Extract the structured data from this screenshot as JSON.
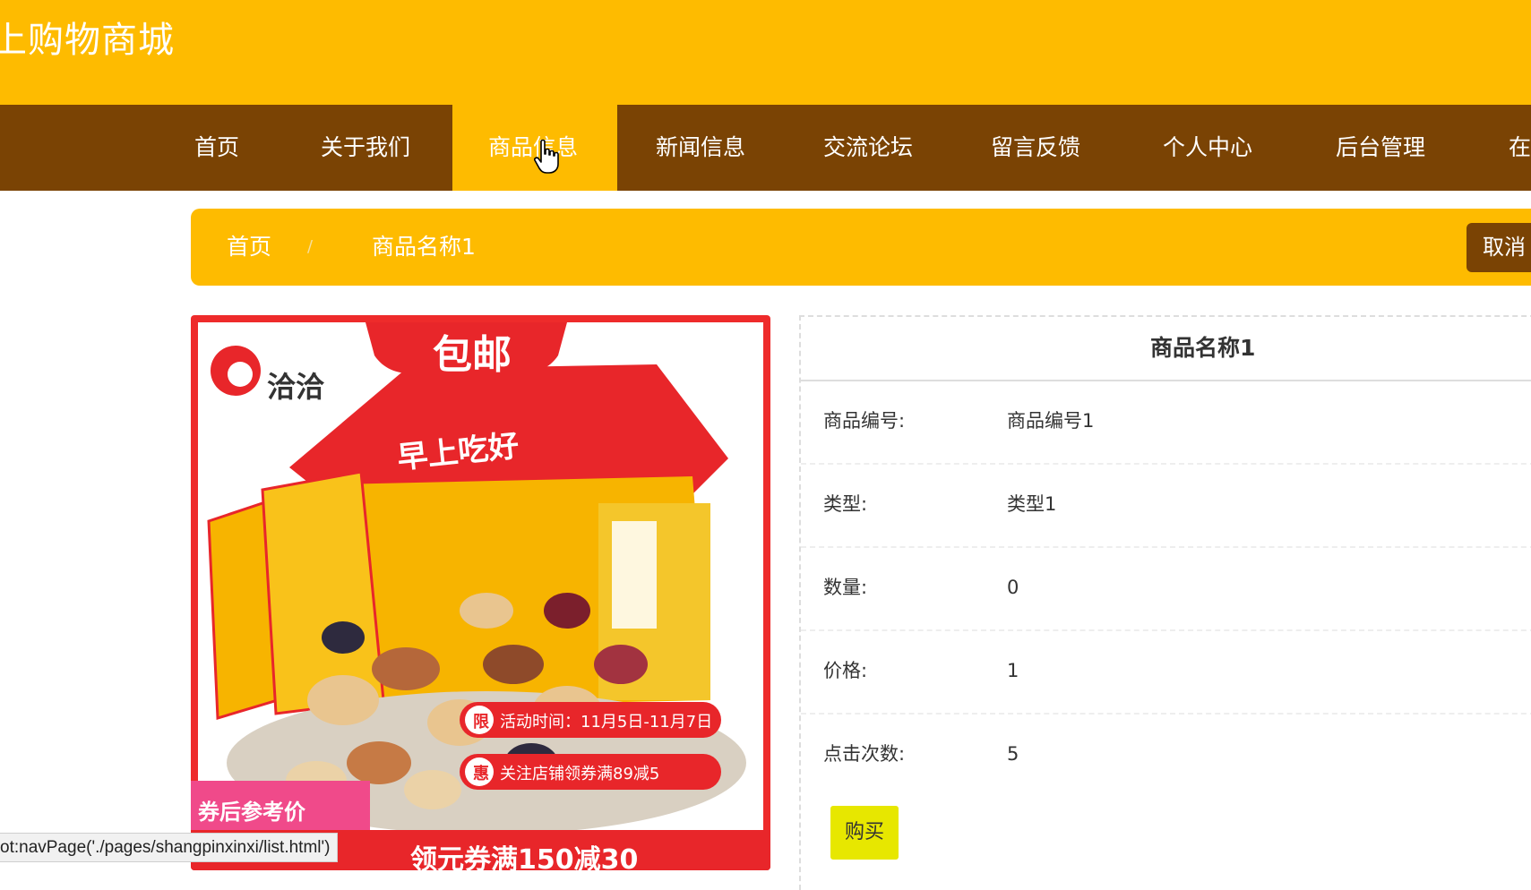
{
  "site": {
    "title": "上购物商城"
  },
  "nav": {
    "items": [
      {
        "label": "首页"
      },
      {
        "label": "关于我们"
      },
      {
        "label": "商品信息",
        "active": true
      },
      {
        "label": "新闻信息"
      },
      {
        "label": "交流论坛"
      },
      {
        "label": "留言反馈"
      },
      {
        "label": "个人中心"
      },
      {
        "label": "后台管理"
      },
      {
        "label": "在"
      }
    ]
  },
  "breadcrumb": {
    "home": "首页",
    "separator": "/",
    "current": "商品名称1"
  },
  "cancel_label": "取消",
  "product_image": {
    "badge": "包邮",
    "brand": "洽洽",
    "box_text": "早上吃好",
    "promo1_tag": "限",
    "promo1": "活动时间：11月5日-11月7日",
    "promo2_tag": "惠",
    "promo2": "关注店铺领券满89减5",
    "price_tag": "券后参考价",
    "coupon": "领元券满150减30"
  },
  "detail": {
    "title": "商品名称1",
    "rows": [
      {
        "label": "商品编号:",
        "value": "商品编号1"
      },
      {
        "label": "类型:",
        "value": "类型1"
      },
      {
        "label": "数量:",
        "value": "0"
      },
      {
        "label": "价格:",
        "value": "1"
      },
      {
        "label": "点击次数:",
        "value": "5"
      }
    ],
    "buy_label": "购买"
  },
  "status_bar": {
    "text": "ot:navPage('./pages/shangpinxinxi/list.html')"
  },
  "colors": {
    "primary": "#FEBB00",
    "nav_bg": "#7A4304",
    "buy_button": "#E7E700",
    "image_frame": "#EE2B2B"
  }
}
